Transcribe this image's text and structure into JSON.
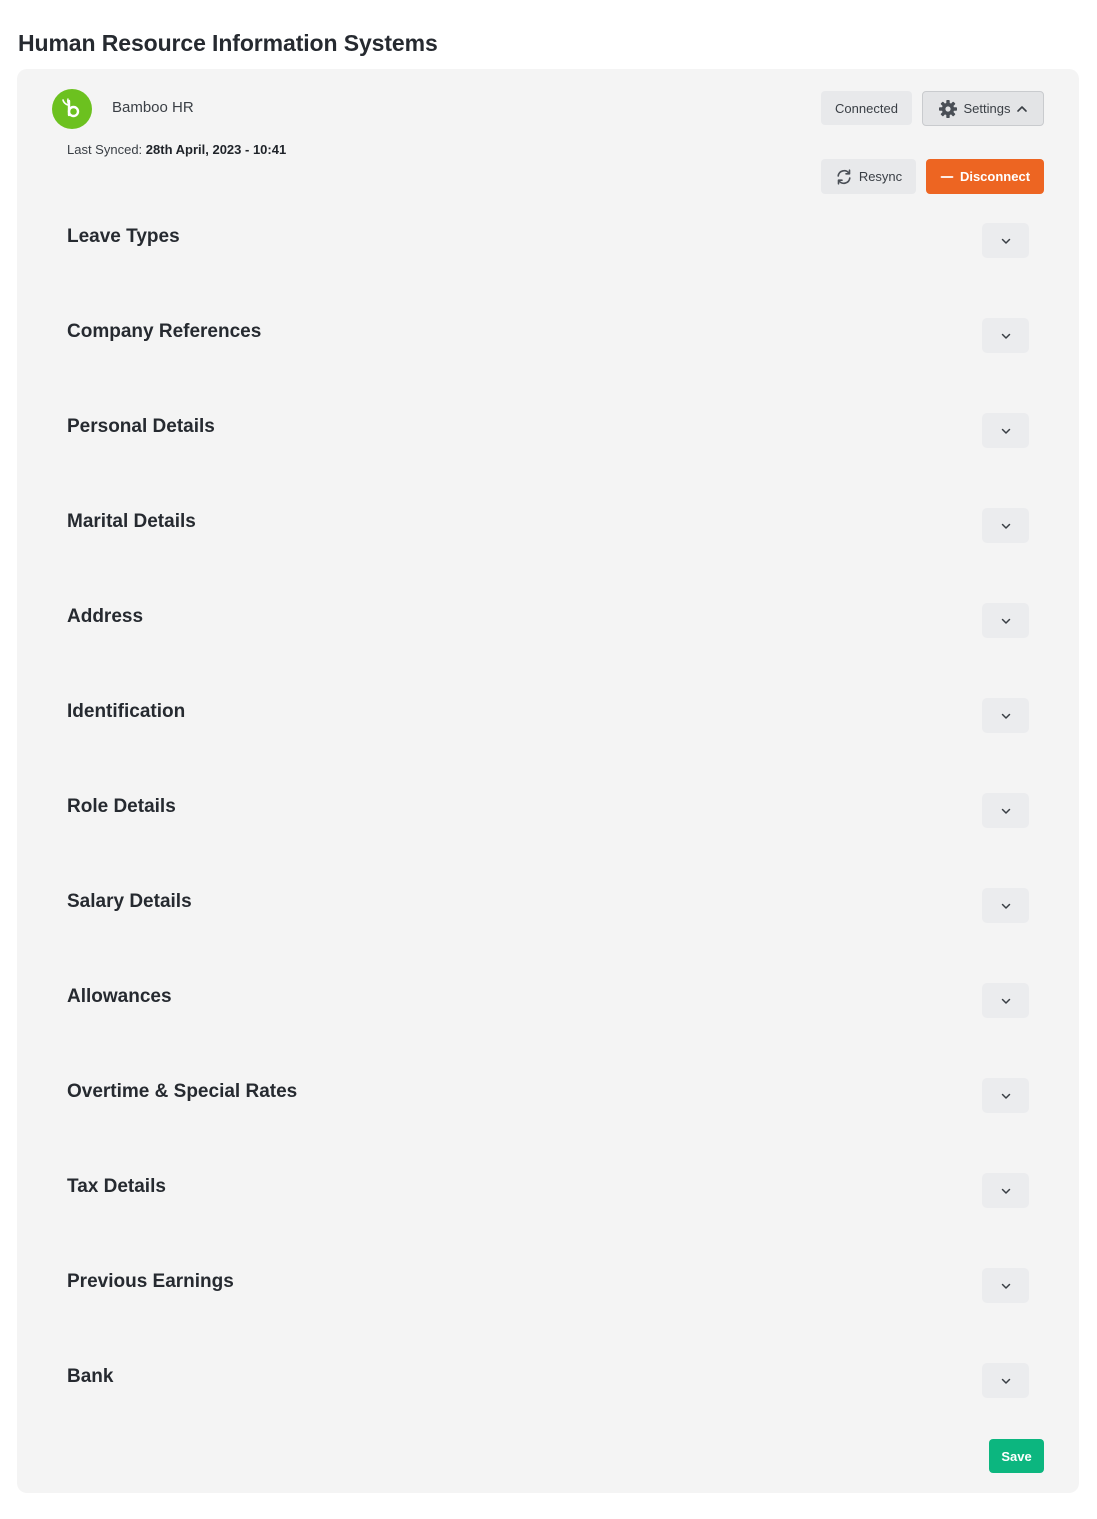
{
  "page": {
    "title": "Human Resource Information Systems"
  },
  "integration": {
    "name": "Bamboo HR",
    "logo_color": "#6cc11f",
    "last_synced_label": "Last Synced:",
    "last_synced_value": "28th April, 2023 - 10:41",
    "status_label": "Connected",
    "settings_label": "Settings",
    "resync_label": "Resync",
    "disconnect_label": "Disconnect",
    "disconnect_color": "#ed6522"
  },
  "sections": [
    {
      "label": "Leave Types",
      "icon": "chevron-down-icon"
    },
    {
      "label": "Company References",
      "icon": "chevron-down-icon"
    },
    {
      "label": "Personal Details",
      "icon": "chevron-down-icon"
    },
    {
      "label": "Marital Details",
      "icon": "chevron-down-icon"
    },
    {
      "label": "Address",
      "icon": "chevron-down-icon"
    },
    {
      "label": "Identification",
      "icon": "chevron-down-icon"
    },
    {
      "label": "Role Details",
      "icon": "chevron-down-icon"
    },
    {
      "label": "Salary Details",
      "icon": "chevron-down-icon"
    },
    {
      "label": "Allowances",
      "icon": "chevron-down-icon"
    },
    {
      "label": "Overtime & Special Rates",
      "icon": "chevron-down-icon"
    },
    {
      "label": "Tax Details",
      "icon": "chevron-down-icon"
    },
    {
      "label": "Previous Earnings",
      "icon": "chevron-down-icon"
    },
    {
      "label": "Bank",
      "icon": "chevron-down-icon"
    }
  ],
  "footer": {
    "save_label": "Save",
    "save_color": "#0cb67f"
  }
}
